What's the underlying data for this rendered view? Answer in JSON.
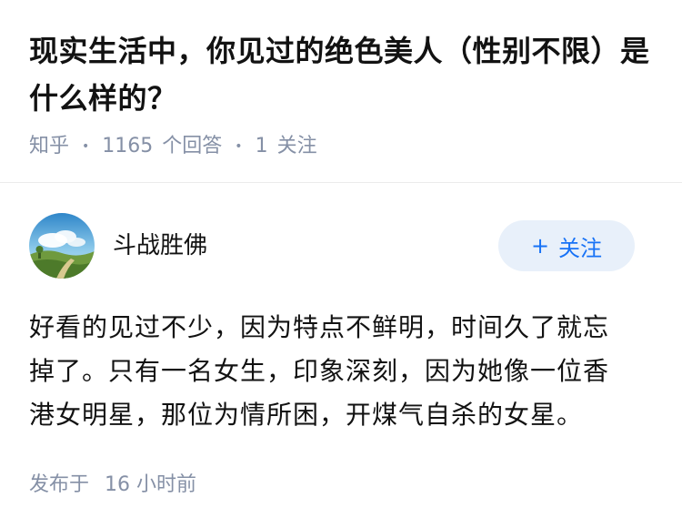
{
  "question": {
    "title": "现实生活中，你见过的绝色美人（性别不限）是什么样的？",
    "source": "知乎",
    "answer_count": "1165",
    "answer_count_label": "个回答",
    "follow_count": "1",
    "follow_label": "关注"
  },
  "answer": {
    "author_name": "斗战胜佛",
    "follow_button_label": "关注",
    "follow_button_icon": "plus-icon",
    "content": "好看的见过不少，因为特点不鲜明，时间久了就忘掉了。只有一名女生，印象深刻，因为她像一位香港女明星，那位为情所困，开煤气自杀的女星。",
    "publish_label": "发布于",
    "publish_time": "16 小时前"
  },
  "colors": {
    "title_text": "#121212",
    "meta_text": "#8590a6",
    "accent_blue": "#1772f6",
    "follow_button_bg": "#e8f0fa",
    "divider": "#ebebeb"
  }
}
